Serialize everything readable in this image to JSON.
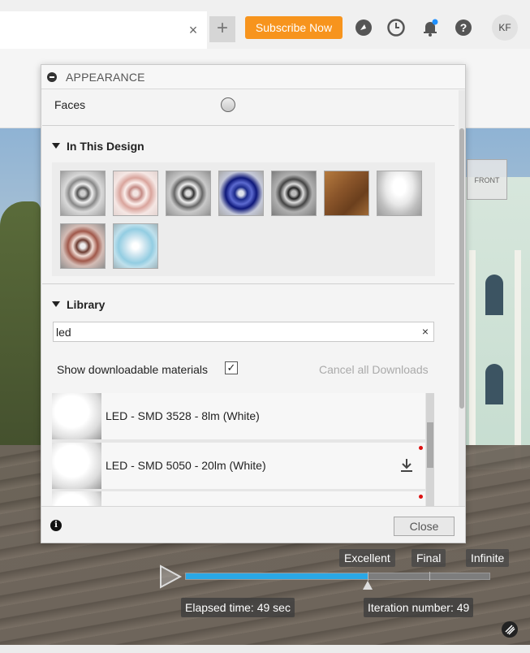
{
  "header": {
    "subscribe_label": "Subscribe Now",
    "avatar_initials": "KF",
    "tab_close_glyph": "×",
    "new_tab_glyph": "+",
    "icons": [
      "compass-icon",
      "clock-icon",
      "bell-icon",
      "help-icon"
    ],
    "accent_color": "#f7941d"
  },
  "dialog": {
    "title": "APPEARANCE",
    "faces_label": "Faces",
    "in_design_title": "In This Design",
    "library_title": "Library",
    "search_value": "led",
    "search_clear": "×",
    "show_downloadable_label": "Show downloadable materials",
    "show_downloadable_checked": true,
    "cancel_downloads_label": "Cancel all Downloads",
    "materials": [
      {
        "name": "LED - SMD 3528 - 8lm (White)",
        "downloadable": false
      },
      {
        "name": "LED - SMD 5050 - 20lm (White)",
        "downloadable": true
      },
      {
        "name": "",
        "downloadable": true
      }
    ],
    "close_label": "Close",
    "info_glyph": "i"
  },
  "render": {
    "quality_labels": [
      "Excellent",
      "Final",
      "Infinite"
    ],
    "progress": 0.6,
    "elapsed_label": "Elapsed time: 49 sec",
    "iteration_label": "Iteration number: 49",
    "progress_color": "#2aa8e6"
  },
  "viewcube_label": "FRONT"
}
